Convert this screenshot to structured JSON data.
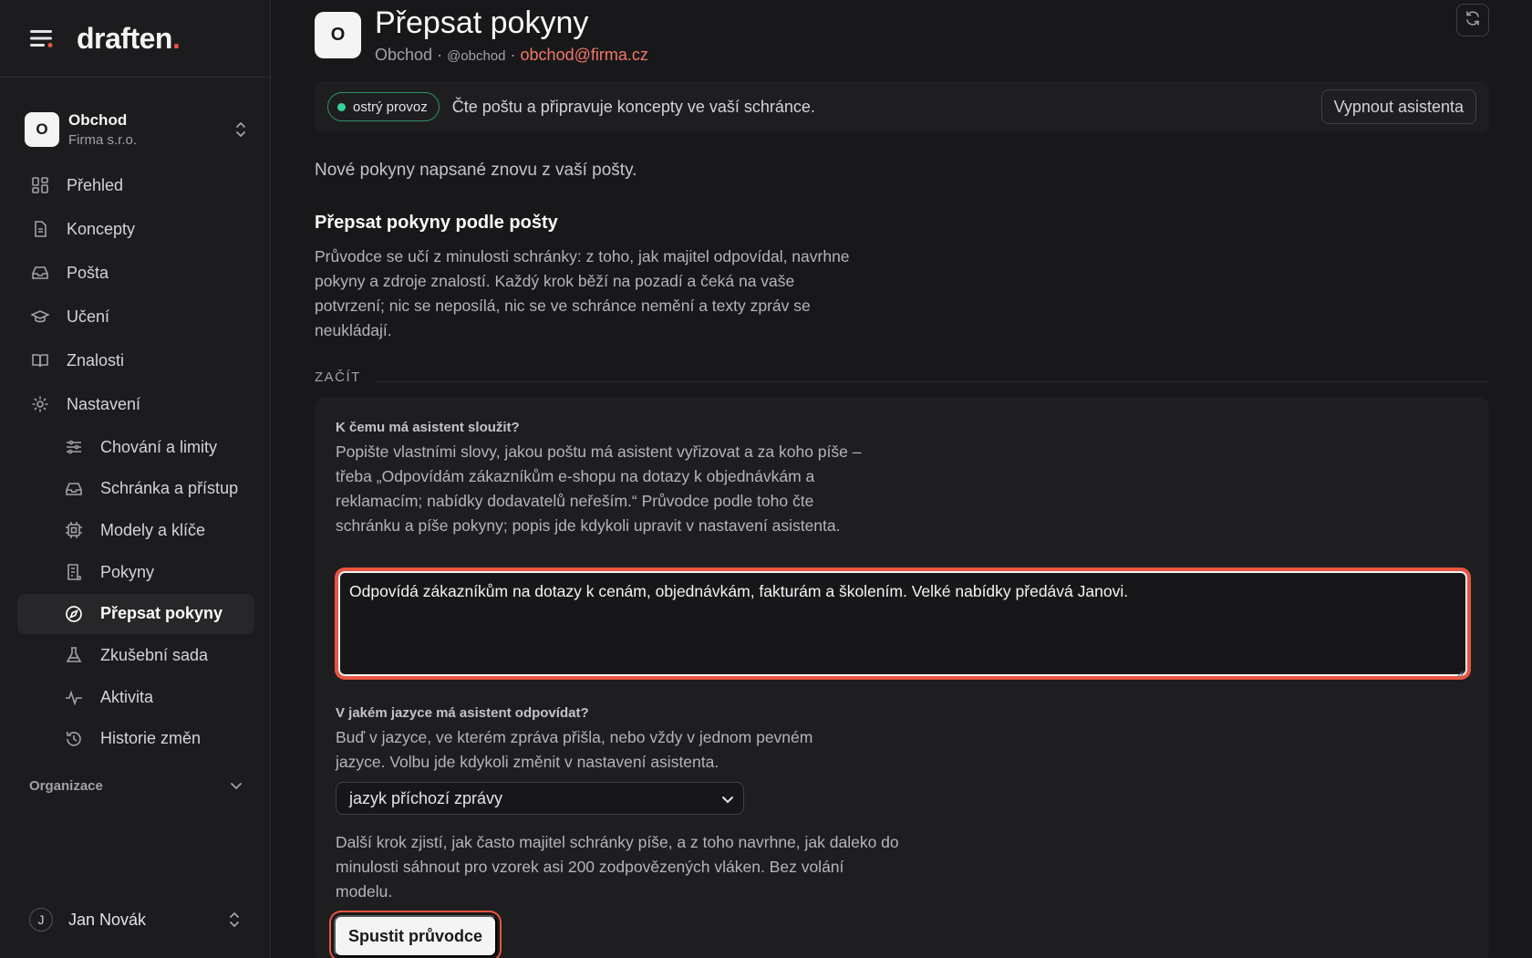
{
  "brand": {
    "name": "draften",
    "dot": "."
  },
  "account": {
    "initial": "O",
    "name": "Obchod",
    "company": "Firma s.r.o."
  },
  "nav": {
    "items": [
      {
        "label": "Přehled",
        "icon": "dashboard-icon"
      },
      {
        "label": "Koncepty",
        "icon": "document-icon"
      },
      {
        "label": "Pošta",
        "icon": "inbox-icon"
      },
      {
        "label": "Učení",
        "icon": "graduation-cap-icon"
      },
      {
        "label": "Znalosti",
        "icon": "book-icon"
      },
      {
        "label": "Nastavení",
        "icon": "gear-icon"
      }
    ],
    "sub_items": [
      {
        "label": "Chování a limity",
        "icon": "sliders-icon"
      },
      {
        "label": "Schránka a přístup",
        "icon": "inbox-icon"
      },
      {
        "label": "Modely a klíče",
        "icon": "chip-icon"
      },
      {
        "label": "Pokyny",
        "icon": "instructions-icon"
      },
      {
        "label": "Přepsat pokyny",
        "icon": "compass-icon",
        "active": true
      },
      {
        "label": "Zkušební sada",
        "icon": "flask-icon"
      },
      {
        "label": "Aktivita",
        "icon": "activity-icon"
      },
      {
        "label": "Historie změn",
        "icon": "history-icon"
      }
    ],
    "org_label": "Organizace"
  },
  "user": {
    "initial": "J",
    "name": "Jan Novák"
  },
  "header": {
    "avatar_initial": "O",
    "title": "Přepsat pokyny",
    "mailbox_name": "Obchod",
    "handle": "@obchod",
    "email": "obchod@firma.cz"
  },
  "status": {
    "badge": "ostrý provoz",
    "text": "Čte poštu a připravuje koncepty ve vaší schránce.",
    "disable_button": "Vypnout asistenta"
  },
  "intro": "Nové pokyny napsané znovu z vaší pošty.",
  "section": {
    "title": "Přepsat pokyny podle pošty",
    "description": "Průvodce se učí z minulosti schránky: z toho, jak majitel odpovídal, navrhne pokyny a zdroje znalostí. Každý krok běží na pozadí a čeká na vaše potvrzení; nic se neposílá, nic se ve schránce nemění a texty zpráv se neukládají."
  },
  "divider": "ZAČÍT",
  "form": {
    "purpose_label": "K čemu má asistent sloužit?",
    "purpose_desc": "Popište vlastními slovy, jakou poštu má asistent vyřizovat a za koho píše – třeba „Odpovídám zákazníkům e-shopu na dotazy k objednávkám a reklamacím; nabídky dodavatelů neřeším.“ Průvodce podle toho čte schránku a píše pokyny; popis jde kdykoli upravit v nastavení asistenta.",
    "purpose_value": "Odpovídá zákazníkům na dotazy k cenám, objednávkám, fakturám a školením. Velké nabídky předává Janovi.",
    "language_label": "V jakém jazyce má asistent odpovídat?",
    "language_desc": "Buď v jazyce, ve kterém zpráva přišla, nebo vždy v jednom pevném jazyce. Volbu jde kdykoli změnit v nastavení asistenta.",
    "language_value": "jazyk příchozí zprávy",
    "note": "Další krok zjistí, jak často majitel schránky píše, a z toho navrhne, jak daleko do minulosti sáhnout pro vzorek asi 200 zodpovězených vláken. Bez volání modelu.",
    "start_button": "Spustit průvodce"
  },
  "colors": {
    "accent": "#e8553f",
    "live": "#34d399",
    "background": "#18181b"
  }
}
